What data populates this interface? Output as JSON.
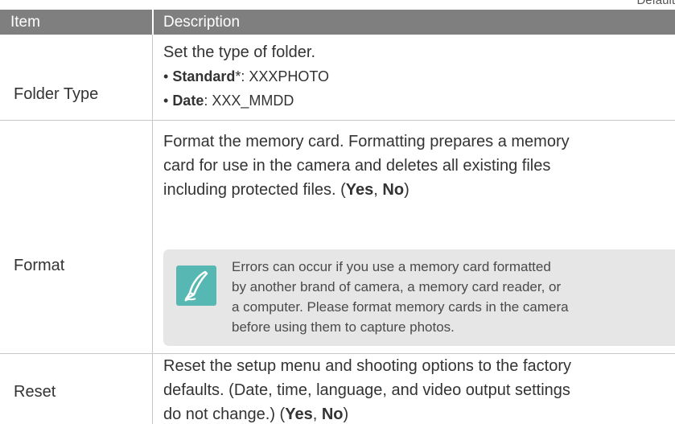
{
  "corner_note": "Default",
  "header": {
    "item": "Item",
    "description": "Description"
  },
  "rows": [
    {
      "label": "Folder Type",
      "intro": "Set the type of folder.",
      "bullets": [
        {
          "term": "Standard",
          "suffix": "*: XXXPHOTO"
        },
        {
          "term": "Date",
          "suffix": ": XXX_MMDD"
        }
      ]
    },
    {
      "label": "Format",
      "lines": [
        "Format the memory card. Formatting prepares a memory",
        "card for use in the camera and deletes all existing files",
        "including protected files. ("
      ],
      "opt_yes": "Yes",
      "opt_sep": ", ",
      "opt_no": "No",
      "opt_end": ")",
      "note_icon": "pen-icon",
      "note_lines": [
        "Errors can occur if you use a memory card formatted",
        "by another brand of camera, a memory card reader, or",
        "a computer. Please format memory cards in the camera",
        "before using them to capture photos."
      ]
    },
    {
      "label": "Reset",
      "lines": [
        "Reset the setup menu and shooting options to the factory",
        "defaults. (Date, time, language, and video output settings",
        "do not change.) ("
      ],
      "opt_yes": "Yes",
      "opt_sep": ", ",
      "opt_no": "No",
      "opt_end": ")"
    }
  ],
  "colors": {
    "header_bg": "#7f7f7f",
    "note_bg": "#e6e6e6",
    "note_icon_bg": "#57b7b2"
  }
}
